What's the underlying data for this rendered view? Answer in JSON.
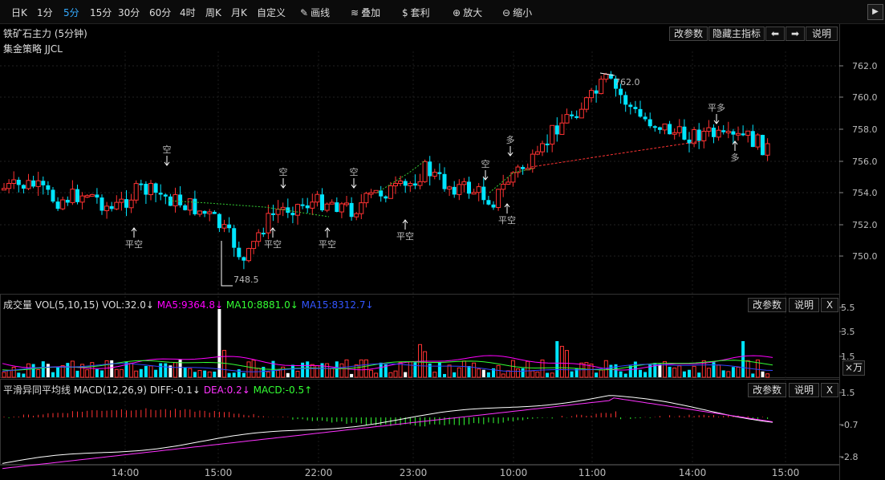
{
  "toolbar": {
    "periods": [
      "日K",
      "1分",
      "5分",
      "15分",
      "30分",
      "60分",
      "4时",
      "周K",
      "月K",
      "自定义"
    ],
    "active_period": "5分",
    "tools": [
      {
        "icon": "pencil-icon",
        "glyph": "✎",
        "label": "画线"
      },
      {
        "icon": "stack-icon",
        "glyph": "≋",
        "label": "叠加"
      },
      {
        "icon": "money-bag-icon",
        "glyph": "$",
        "label": "套利"
      },
      {
        "icon": "zoom-in-icon",
        "glyph": "⊕",
        "label": "放大"
      },
      {
        "icon": "zoom-out-icon",
        "glyph": "⊖",
        "label": "缩小"
      }
    ],
    "expand_glyph": "▶"
  },
  "main_panel": {
    "title": "铁矿石主力 (5分钟)",
    "strategy": "集金策略 JJCL",
    "buttons": {
      "params": "改参数",
      "hide": "隐藏主指标",
      "prev": "⬅",
      "next": "➡",
      "help": "说明"
    },
    "price_axis": [
      "762.0",
      "760.0",
      "758.0",
      "756.0",
      "754.0",
      "752.0",
      "750.0"
    ],
    "high_label": "762.0",
    "low_label": "748.5",
    "signals": [
      {
        "text": "空",
        "color": "#33cc33"
      },
      {
        "text": "平空",
        "color": "#ff3333"
      },
      {
        "text": "平空",
        "color": "#ff3333"
      },
      {
        "text": "空",
        "color": "#33cc33"
      },
      {
        "text": "平空",
        "color": "#ff3333"
      },
      {
        "text": "空",
        "color": "#33cc33"
      },
      {
        "text": "平空",
        "color": "#ff3333"
      },
      {
        "text": "空",
        "color": "#33cc33"
      },
      {
        "text": "多",
        "color": "#ff3333"
      },
      {
        "text": "平空",
        "color": "#ff3333"
      },
      {
        "text": "平多",
        "color": "#33cc33"
      },
      {
        "text": "多",
        "color": "#ff3333"
      }
    ]
  },
  "volume_panel": {
    "title": "成交量",
    "indicator": "VOL(5,10,15)",
    "vol": "VOL:32.0↓",
    "ma5": "MA5:9364.8↓",
    "ma10": "MA10:8881.0↓",
    "ma15": "MA15:8312.7↓",
    "buttons": {
      "params": "改参数",
      "help": "说明",
      "close": "X"
    },
    "axis": [
      "5.5",
      "3.5",
      "1.5"
    ],
    "unit": "×万"
  },
  "macd_panel": {
    "title": "平滑异同平均线",
    "indicator": "MACD(12,26,9)",
    "diff": "DIFF:-0.1↓",
    "dea": "DEA:0.2↓",
    "macd": "MACD:-0.5↑",
    "buttons": {
      "params": "改参数",
      "help": "说明",
      "close": "X"
    },
    "axis": [
      "1.5",
      "-0.7",
      "-2.8"
    ]
  },
  "time_axis": [
    "14:00",
    "15:00",
    "22:00",
    "23:00",
    "10:00",
    "11:00",
    "14:00",
    "15:00"
  ],
  "colors": {
    "up": "#ff3232",
    "down": "#00e5ff",
    "ma5": "#ff00ff",
    "ma10": "#33ff33",
    "ma15": "#3344ff",
    "dea": "#ff33ff",
    "diff": "#ffffff"
  }
}
